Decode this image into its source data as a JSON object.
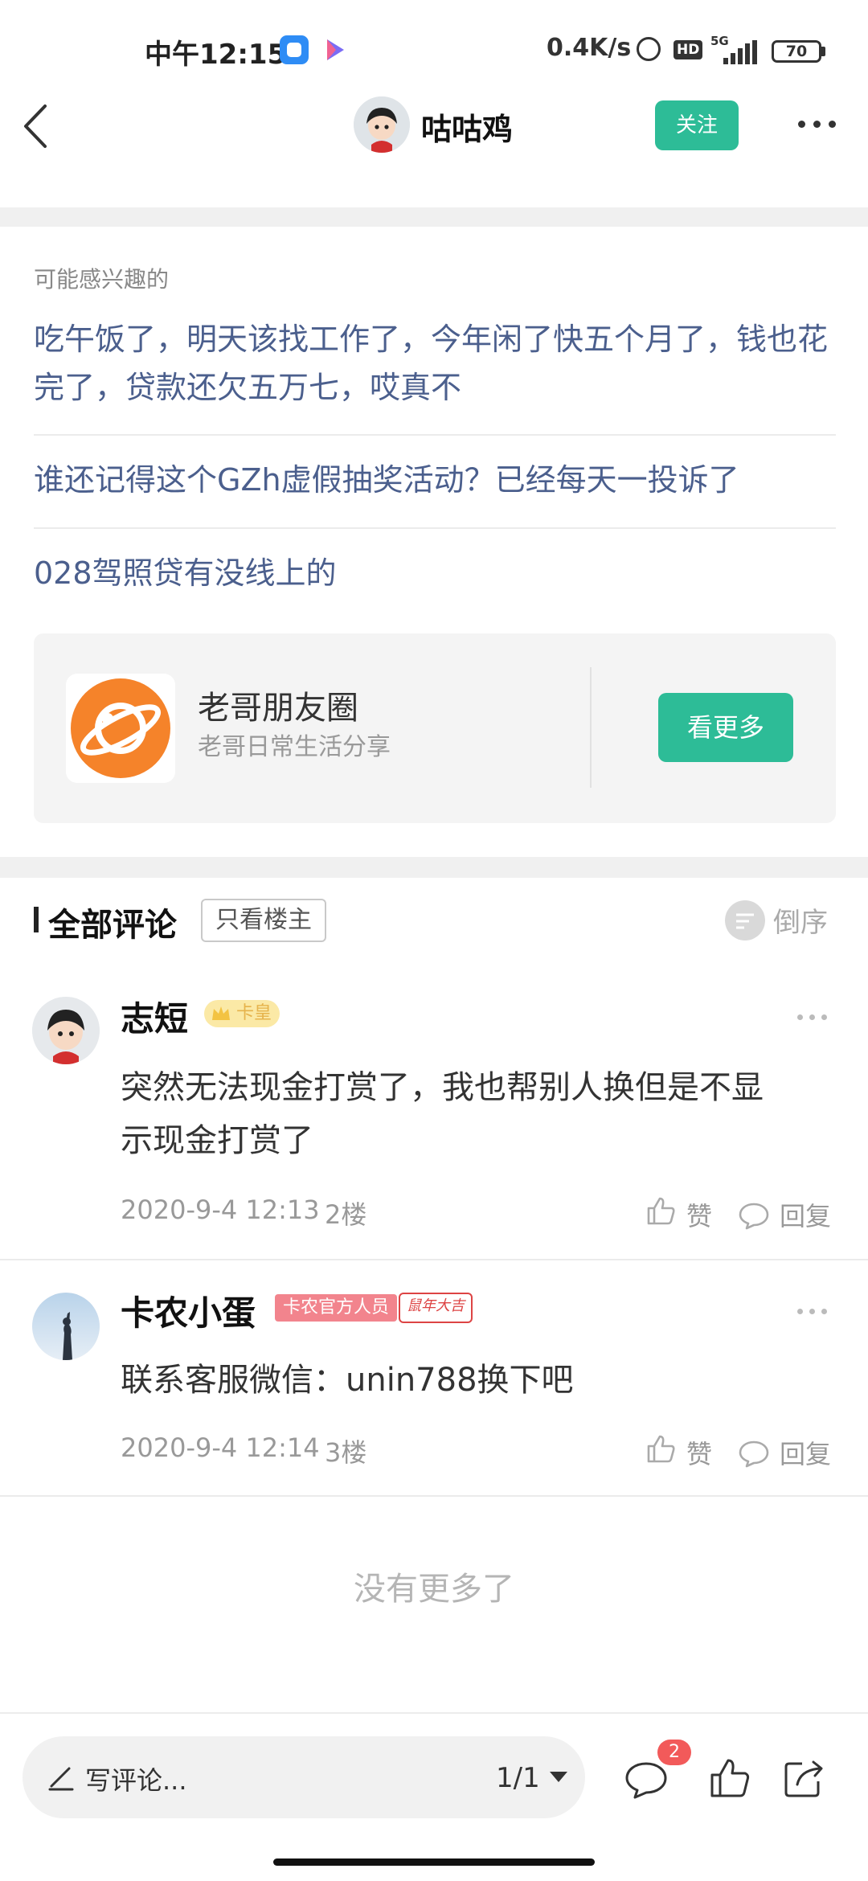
{
  "status_bar": {
    "time": "中午12:15",
    "net_speed": "0.4K/s",
    "hd": "HD",
    "network": "5G",
    "battery": "70"
  },
  "header": {
    "title": "咕咕鸡",
    "follow_label": "关注"
  },
  "related": {
    "heading": "可能感兴趣的",
    "items": [
      "吃午饭了，明天该找工作了，今年闲了快五个月了，钱也花完了，贷款还欠五万七，哎真不",
      "谁还记得这个GZh虚假抽奖活动？已经每天一投诉了",
      "028驾照贷有没线上的"
    ]
  },
  "circle_card": {
    "name": "老哥朋友圈",
    "subtitle": "老哥日常生活分享",
    "button": "看更多"
  },
  "comments_header": {
    "title": "全部评论",
    "only_host": "只看楼主",
    "sort": "倒序"
  },
  "comments": [
    {
      "name": "志短",
      "badge": "卡皇",
      "text_line1": "突然无法现金打赏了，我也帮别人换但是不显",
      "text_line2": "示现金打赏了",
      "date": "2020-9-4 12:13",
      "floor": "2楼",
      "like_label": "赞",
      "reply_label": "回复"
    },
    {
      "name": "卡农小蛋",
      "badge": "卡农官方人员",
      "badge2": "鼠年大吉",
      "text_line1": "联系客服微信：unin788换下吧",
      "date": "2020-9-4 12:14",
      "floor": "3楼",
      "like_label": "赞",
      "reply_label": "回复"
    }
  ],
  "no_more": "没有更多了",
  "bottom_bar": {
    "placeholder": "写评论...",
    "page": "1/1",
    "comment_count": "2"
  },
  "colors": {
    "accent": "#2dbc97",
    "link": "#4b5f8d",
    "badge_red": "#f25a5a"
  }
}
